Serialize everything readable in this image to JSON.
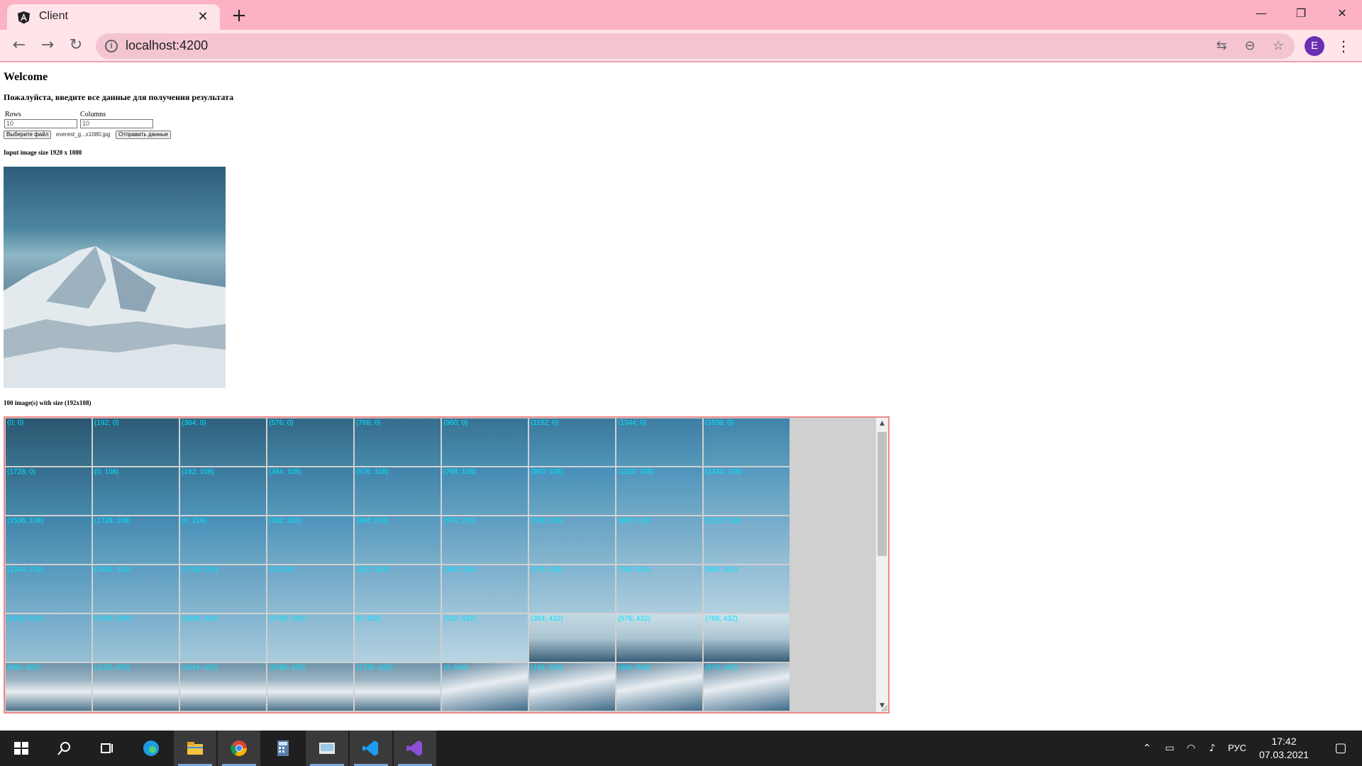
{
  "browser": {
    "tab_title": "Client",
    "url": "localhost:4200",
    "profile_initial": "E",
    "accent_color": "#fdb2c4"
  },
  "page": {
    "heading": "Welcome",
    "instruction": "Пожалуйста, введите все данные для получения результата",
    "form": {
      "rows_label": "Rows",
      "rows_value": "10",
      "columns_label": "Columns",
      "columns_value": "10",
      "choose_file_label": "Выберите файл",
      "file_name": "everest_g...x1080.jpg",
      "submit_label": "Отправить данные"
    },
    "input_size_text": "Input image size 1920 x 1080",
    "output_count_text": "100 image(s) with size (192x108)",
    "tile_label_color": "#00e5ff",
    "tiles": [
      "(0; 0)",
      "(192; 0)",
      "(384; 0)",
      "(576; 0)",
      "(768; 0)",
      "(960; 0)",
      "(1152; 0)",
      "(1344; 0)",
      "(1536; 0)",
      "(1728; 0)",
      "(0; 108)",
      "(192; 108)",
      "(384; 108)",
      "(576; 108)",
      "(768; 108)",
      "(960; 108)",
      "(1152; 108)",
      "(1344; 108)",
      "(1536; 108)",
      "(1728; 108)",
      "(0; 216)",
      "(192; 216)",
      "(384; 216)",
      "(576; 216)",
      "(768; 216)",
      "(960; 216)",
      "(1152; 216)",
      "(1344; 216)",
      "(1536; 216)",
      "(1728; 216)",
      "(0; 324)",
      "(192; 324)",
      "(384; 324)",
      "(576; 324)",
      "(768; 324)",
      "(960; 324)",
      "(1152; 324)",
      "(1344; 324)",
      "(1536; 324)",
      "(1728; 324)",
      "(0; 432)",
      "(192; 432)",
      "(384; 432)",
      "(576; 432)",
      "(768; 432)",
      "(960; 432)",
      "(1152; 432)",
      "(1344; 432)",
      "(1536; 432)",
      "(1728; 432)",
      "(0; 540)",
      "(192; 540)",
      "(384; 540)",
      "(576; 540)"
    ]
  },
  "taskbar": {
    "apps": [
      "start-icon",
      "search-icon",
      "task-view-icon",
      "edge-icon",
      "file-explorer-icon",
      "chrome-icon",
      "calculator-icon",
      "paint-icon",
      "vscode-icon",
      "visual-studio-icon"
    ],
    "language": "РУС",
    "time": "17:42",
    "date": "07.03.2021"
  }
}
